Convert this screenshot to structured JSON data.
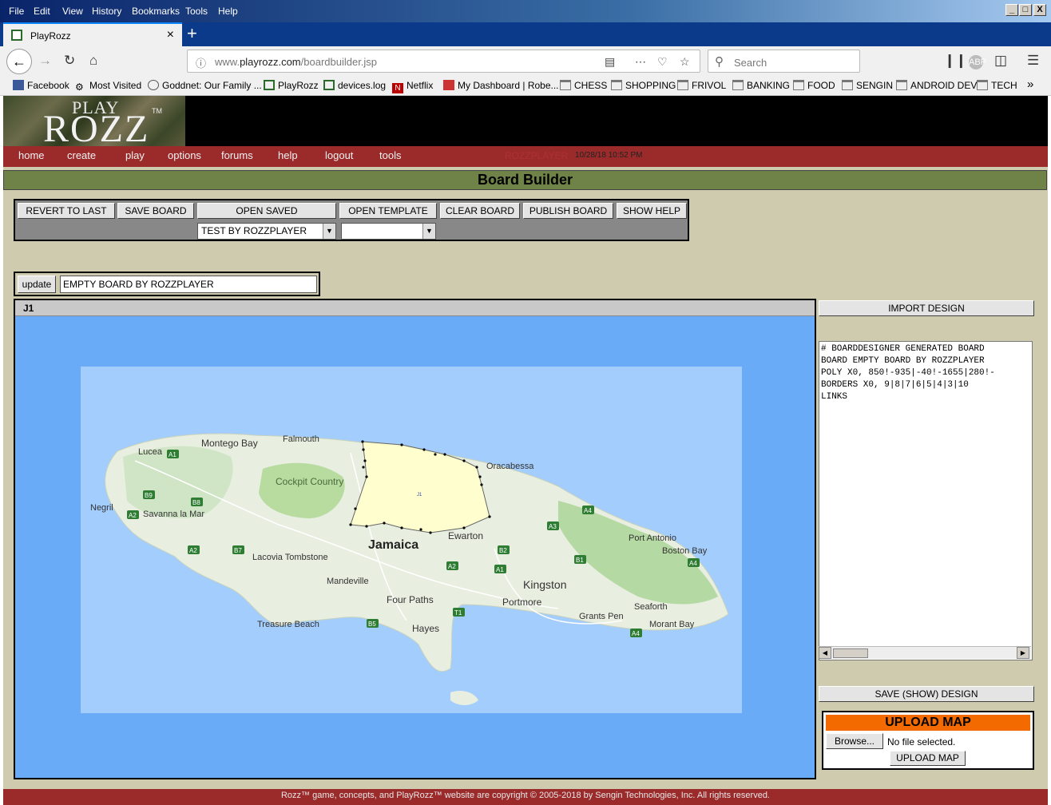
{
  "menu": [
    "File",
    "Edit",
    "View",
    "History",
    "Bookmarks",
    "Tools",
    "Help"
  ],
  "window_controls": [
    "_",
    "□",
    "X"
  ],
  "tab": {
    "title": "PlayRozz",
    "close": "×",
    "new_tab": "+"
  },
  "address": {
    "url_prefix": "www.",
    "url_domain": "playrozz.com",
    "url_path": "/boardbuilder.jsp",
    "search_placeholder": "Search"
  },
  "bookmarks": [
    "Facebook",
    "Most Visited",
    "Goddnet: Our Family ...",
    "PlayRozz",
    "devices.log",
    "Netflix",
    "My Dashboard | Robe...",
    "CHESS",
    "SHOPPING",
    "FRIVOL",
    "BANKING",
    "FOOD",
    "SENGIN",
    "ANDROID DEV",
    "TECH"
  ],
  "logo": {
    "play": "PLAY",
    "rozz": "ROZZ",
    "tm": "TM"
  },
  "site_nav": [
    "home",
    "create",
    "play",
    "options",
    "forums",
    "help",
    "logout",
    "tools"
  ],
  "user": {
    "name": "ROZZPLAYER",
    "datetime": "10/28/18 10:52 PM"
  },
  "page_title": "Board Builder",
  "toolbar": {
    "revert": "REVERT TO LAST",
    "save": "SAVE BOARD",
    "open_saved": "OPEN SAVED",
    "open_template": "OPEN TEMPLATE",
    "clear": "CLEAR BOARD",
    "publish": "PUBLISH BOARD",
    "show_help": "SHOW HELP",
    "saved_selected": "TEST BY ROZZPLAYER",
    "template_selected": ""
  },
  "update": {
    "button": "update",
    "board_name": "EMPTY BOARD BY ROZZPLAYER"
  },
  "region": {
    "label": "J1",
    "marker": "J1"
  },
  "map_labels": {
    "country": "Jamaica",
    "places": [
      "Montego Bay",
      "Falmouth",
      "Lucea",
      "Cockpit Country",
      "Oracabessa",
      "Negril",
      "Savanna la Mar",
      "Lacovia Tombstone",
      "Mandeville",
      "Ewarton",
      "Four Paths",
      "Kingston",
      "Portmore",
      "Port Antonio",
      "Boston Bay",
      "Seaforth",
      "Grants Pen",
      "Morant Bay",
      "Treasure Beach",
      "Hayes"
    ],
    "roads": [
      "A1",
      "B9",
      "B8",
      "A2",
      "A2",
      "B7",
      "A2",
      "B2",
      "A1",
      "T1",
      "A3",
      "A4",
      "B1",
      "A4",
      "A4",
      "B5"
    ]
  },
  "right_panel": {
    "import": "IMPORT DESIGN",
    "design_text": "# BOARDDESIGNER GENERATED BOARD\nBOARD EMPTY BOARD BY ROZZPLAYER\nPOLY X0, 850!-935|-40!-1655|280!-\nBORDERS X0, 9|8|7|6|5|4|3|10\nLINKS",
    "save_show": "SAVE (SHOW) DESIGN",
    "upload_title": "UPLOAD MAP",
    "browse": "Browse...",
    "file_status": "No file selected.",
    "upload_button": "UPLOAD MAP"
  },
  "footer": "Rozz™ game, concepts, and PlayRozz™ website are copyright © 2005-2018 by Sengin Technologies, Inc. All rights reserved.",
  "colors": {
    "nav_red": "#9b2b2b",
    "title_green": "#6f8348",
    "page_bg": "#cfcbae",
    "sea": "#6aabf8",
    "polygon": "#ffffcc",
    "upload_orange": "#f26a00"
  }
}
